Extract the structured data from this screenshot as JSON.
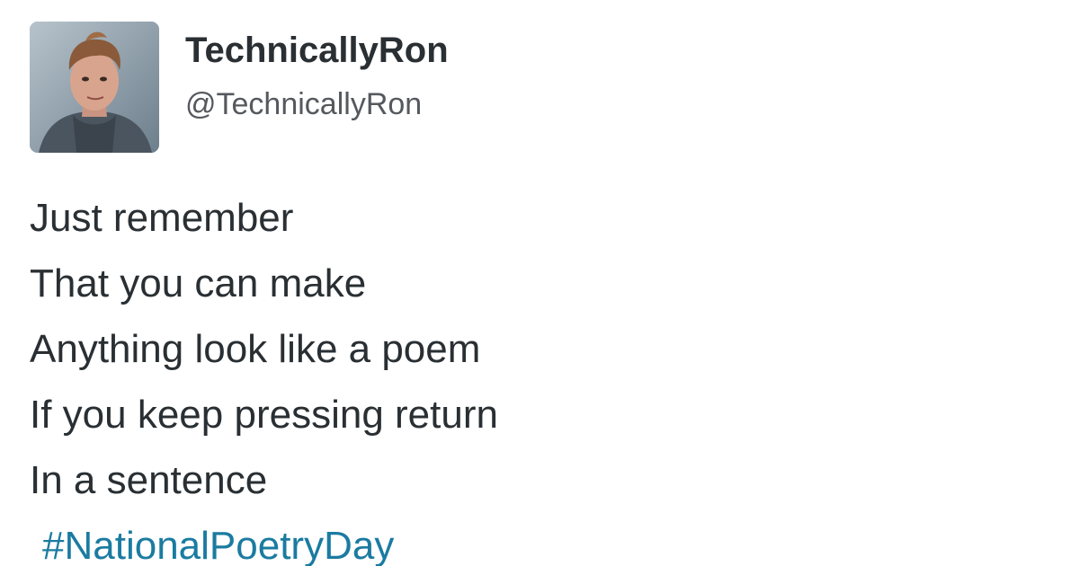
{
  "tweet": {
    "author": {
      "display_name": "TechnicallyRon",
      "handle": "@TechnicallyRon"
    },
    "lines": [
      "Just remember",
      "That you can make",
      "Anything look like a poem",
      "If you keep pressing return",
      "In a sentence"
    ],
    "hashtag": "#NationalPoetryDay"
  },
  "colors": {
    "text": "#292f33",
    "handle": "#55595e",
    "hashtag": "#1b7ba1",
    "background": "#ffffff"
  }
}
